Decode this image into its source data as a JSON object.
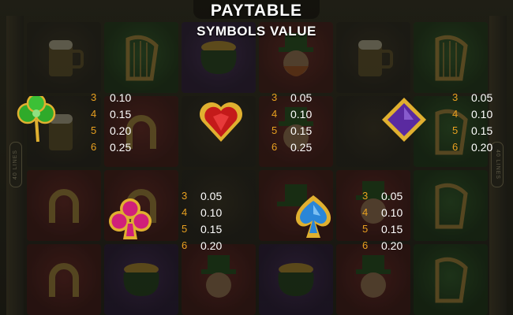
{
  "header": {
    "title": "PAYTABLE",
    "subtitle": "SYMBOLS VALUE"
  },
  "side_labels": {
    "left": "40 LINES",
    "right": "40 LINES"
  },
  "reel_icons": [
    [
      "beer-mug-icon",
      "harp-icon",
      "pot-of-gold-icon",
      "leprechaun-icon",
      "beer-mug-icon",
      "harp-icon"
    ],
    [
      "clover-icon",
      "horseshoe-icon",
      "heart-icon",
      "leprechaun-icon",
      "club-icon",
      "harp-icon"
    ],
    [
      "horseshoe-icon",
      "horseshoe-icon",
      "hat-icon",
      "leprechaun-icon",
      "leprechaun-icon",
      "harp-icon"
    ],
    [
      "horseshoe-icon",
      "pot-of-gold-icon",
      "leprechaun-icon",
      "pot-of-gold-icon",
      "leprechaun-icon",
      "harp-icon"
    ]
  ],
  "colors": {
    "count_color": "#e8a020",
    "value_color": "#ffffff",
    "clover": "#2faa2a",
    "heart": "#c41a1a",
    "diamond": "#5a2aa0",
    "club": "#d0207a",
    "spade": "#2a86d8",
    "gold": "#e0b030"
  },
  "paytable": [
    {
      "symbol": "clover-icon",
      "rows": [
        {
          "count": "3",
          "value": "0.10"
        },
        {
          "count": "4",
          "value": "0.15"
        },
        {
          "count": "5",
          "value": "0.20"
        },
        {
          "count": "6",
          "value": "0.25"
        }
      ]
    },
    {
      "symbol": "heart-gem-icon",
      "rows": [
        {
          "count": "3",
          "value": "0.05"
        },
        {
          "count": "4",
          "value": "0.10"
        },
        {
          "count": "5",
          "value": "0.15"
        },
        {
          "count": "6",
          "value": "0.25"
        }
      ]
    },
    {
      "symbol": "diamond-gem-icon",
      "rows": [
        {
          "count": "3",
          "value": "0.05"
        },
        {
          "count": "4",
          "value": "0.10"
        },
        {
          "count": "5",
          "value": "0.15"
        },
        {
          "count": "6",
          "value": "0.20"
        }
      ]
    },
    {
      "symbol": "club-gem-icon",
      "rows": [
        {
          "count": "3",
          "value": "0.05"
        },
        {
          "count": "4",
          "value": "0.10"
        },
        {
          "count": "5",
          "value": "0.15"
        },
        {
          "count": "6",
          "value": "0.20"
        }
      ]
    },
    {
      "symbol": "spade-gem-icon",
      "rows": [
        {
          "count": "3",
          "value": "0.05"
        },
        {
          "count": "4",
          "value": "0.10"
        },
        {
          "count": "5",
          "value": "0.15"
        },
        {
          "count": "6",
          "value": "0.20"
        }
      ]
    }
  ]
}
